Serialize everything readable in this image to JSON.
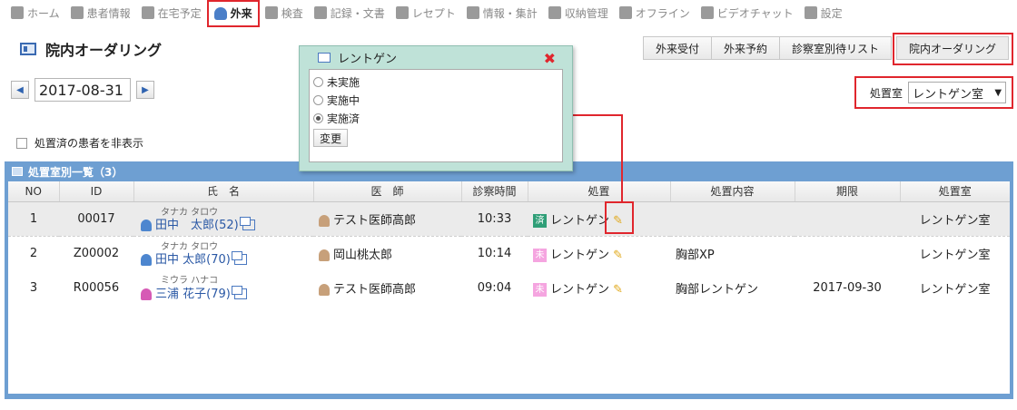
{
  "nav": [
    {
      "name": "home",
      "label": "ホーム",
      "icon": "home-icon"
    },
    {
      "name": "patient-info",
      "label": "患者情報",
      "icon": "patient-icon"
    },
    {
      "name": "home-schedule",
      "label": "在宅予定",
      "icon": "clock-icon"
    },
    {
      "name": "outpatient",
      "label": "外来",
      "icon": "outpatient-icon",
      "active": true
    },
    {
      "name": "exam",
      "label": "検査",
      "icon": "exam-icon"
    },
    {
      "name": "records",
      "label": "記録・文書",
      "icon": "document-icon"
    },
    {
      "name": "receipt",
      "label": "レセプト",
      "icon": "receipt-icon"
    },
    {
      "name": "info-stats",
      "label": "情報・集計",
      "icon": "chart-icon"
    },
    {
      "name": "billing",
      "label": "収納管理",
      "icon": "tag-icon"
    },
    {
      "name": "offline",
      "label": "オフライン",
      "icon": "plug-icon"
    },
    {
      "name": "video-chat",
      "label": "ビデオチャット",
      "icon": "tv-icon"
    },
    {
      "name": "settings",
      "label": "設定",
      "icon": "gear-icon"
    }
  ],
  "page": {
    "title": "院内オーダリング"
  },
  "tabs": [
    {
      "label": "外来受付"
    },
    {
      "label": "外来予約"
    },
    {
      "label": "診察室別待リスト"
    },
    {
      "label": "院内オーダリング",
      "active": true
    }
  ],
  "date": {
    "value": "2017-08-31",
    "prev": "◀",
    "next": "▶"
  },
  "room": {
    "label": "処置室",
    "selected": "レントゲン室",
    "caret": "▼"
  },
  "hide_done": {
    "label": "処置済の患者を非表示"
  },
  "panel": {
    "title": "処置室別一覧（3）"
  },
  "columns": [
    "NO",
    "ID",
    "氏　名",
    "医　師",
    "診察時間",
    "処置",
    "処置内容",
    "期限",
    "処置室"
  ],
  "rows": [
    {
      "no": "1",
      "id": "00017",
      "kana": "タナカ タロウ",
      "name": "田中　太郎(52)",
      "gender": "m",
      "doctor": "テスト医師高郎",
      "time": "10:33",
      "status": "済",
      "status_kind": "done",
      "treatment": "レントゲン",
      "content": "",
      "deadline": "",
      "room": "レントゲン室"
    },
    {
      "no": "2",
      "id": "Z00002",
      "kana": "タナカ タロウ",
      "name": "田中 太郎(70)",
      "gender": "m",
      "doctor": "岡山桃太郎",
      "time": "10:14",
      "status": "未",
      "status_kind": "not",
      "treatment": "レントゲン",
      "content": "胸部XP",
      "deadline": "",
      "room": "レントゲン室"
    },
    {
      "no": "3",
      "id": "R00056",
      "kana": "ミウラ ハナコ",
      "name": "三浦 花子(79)",
      "gender": "f",
      "doctor": "テスト医師高郎",
      "time": "09:04",
      "status": "未",
      "status_kind": "not",
      "treatment": "レントゲン",
      "content": "胸部レントゲン",
      "deadline": "2017-09-30",
      "room": "レントゲン室"
    }
  ],
  "popup": {
    "title": "レントゲン",
    "close": "✖",
    "options": [
      {
        "label": "未実施",
        "checked": false
      },
      {
        "label": "実施中",
        "checked": false
      },
      {
        "label": "実施済",
        "checked": true
      }
    ],
    "button": "変更"
  },
  "colors": {
    "highlight": "#e0262d",
    "panel": "#6e9fd2",
    "popup_bg": "#bfe2d8",
    "done_badge": "#2f9e77",
    "not_badge": "#f5a5e0"
  }
}
